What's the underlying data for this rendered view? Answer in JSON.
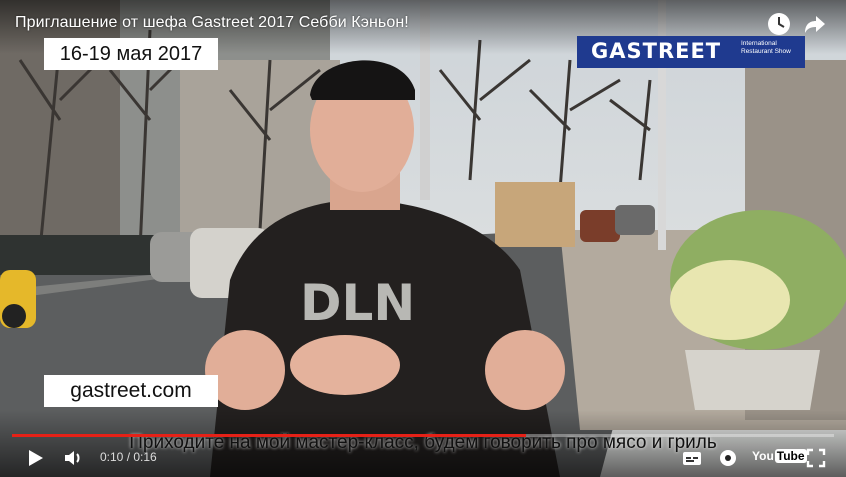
{
  "video": {
    "title": "Приглашение от шефа Gastreet 2017 Себби Кэньон!",
    "current_time": "0:10",
    "duration": "0:16",
    "time_separator": " / ",
    "progress_fraction": 0.625
  },
  "overlay": {
    "date_badge": "16-19 мая 2017",
    "logo_text": "GASTREET",
    "logo_subtext": "International Restaurant Show",
    "url_badge": "gastreet.com",
    "caption": "Приходите на мой мастер-класс, будем говорить про мясо и гриль"
  },
  "shirt_print": "DLN",
  "controls": {
    "youtube_logo": "You",
    "youtube_logo_tube": "Tube"
  },
  "colors": {
    "accent": "#e62117",
    "logo_bg": "#1f3a8f"
  },
  "icons": [
    "watch-later-icon",
    "share-icon",
    "play-icon",
    "volume-icon",
    "subtitles-icon",
    "settings-icon",
    "fullscreen-icon"
  ]
}
